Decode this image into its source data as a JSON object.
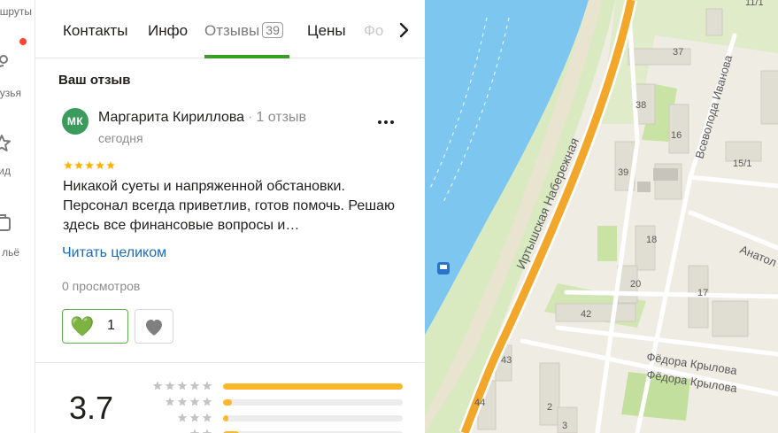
{
  "sidebar": {
    "items": [
      {
        "label": "шруты",
        "icon": "route-icon"
      },
      {
        "label": "узья",
        "icon": "friends-icon"
      },
      {
        "label": "ид",
        "icon": "star-icon"
      },
      {
        "label": "льё",
        "icon": "briefcase-icon"
      }
    ]
  },
  "tabs": [
    {
      "label": "Контакты"
    },
    {
      "label": "Инфо"
    },
    {
      "label": "Отзывы",
      "count": "39"
    },
    {
      "label": "Цены"
    },
    {
      "label": "Фо"
    }
  ],
  "review": {
    "section_title": "Ваш отзыв",
    "avatar_initials": "МК",
    "author": "Маргарита Кириллова",
    "author_reviews": "1 отзыв",
    "date": "сегодня",
    "stars": 5,
    "text": "Никакой суеты и напряженной обстановки. Персонал всегда приветлив, готов помочь. Решаю здесь все финансовые вопросы и…",
    "read_more": "Читать целиком",
    "views": "0 просмотров",
    "likes": "1",
    "like_emoji": "💚"
  },
  "rating": {
    "value": "3.7",
    "rows": [
      {
        "stars": 5,
        "fraction": 1.0
      },
      {
        "stars": 4,
        "fraction": 0.05
      },
      {
        "stars": 3,
        "fraction": 0.03
      },
      {
        "stars": 2,
        "fraction": 0.09
      }
    ]
  },
  "map": {
    "street_labels": [
      "Иртышская Набережная",
      "Всеволода Иванова",
      "Анатол",
      "Фёдора Крылова",
      "Фёдора Крылова"
    ],
    "house_numbers": [
      "11/1",
      "37",
      "38",
      "16",
      "39",
      "15/1",
      "18",
      "20",
      "17",
      "42",
      "43",
      "44",
      "2",
      "3"
    ]
  },
  "colors": {
    "accent_green": "#3d9b2a",
    "link_blue": "#1a6bb8",
    "star_gold": "#ffb300",
    "river": "#79c4ee",
    "embankment_road": "#f2a72a"
  }
}
